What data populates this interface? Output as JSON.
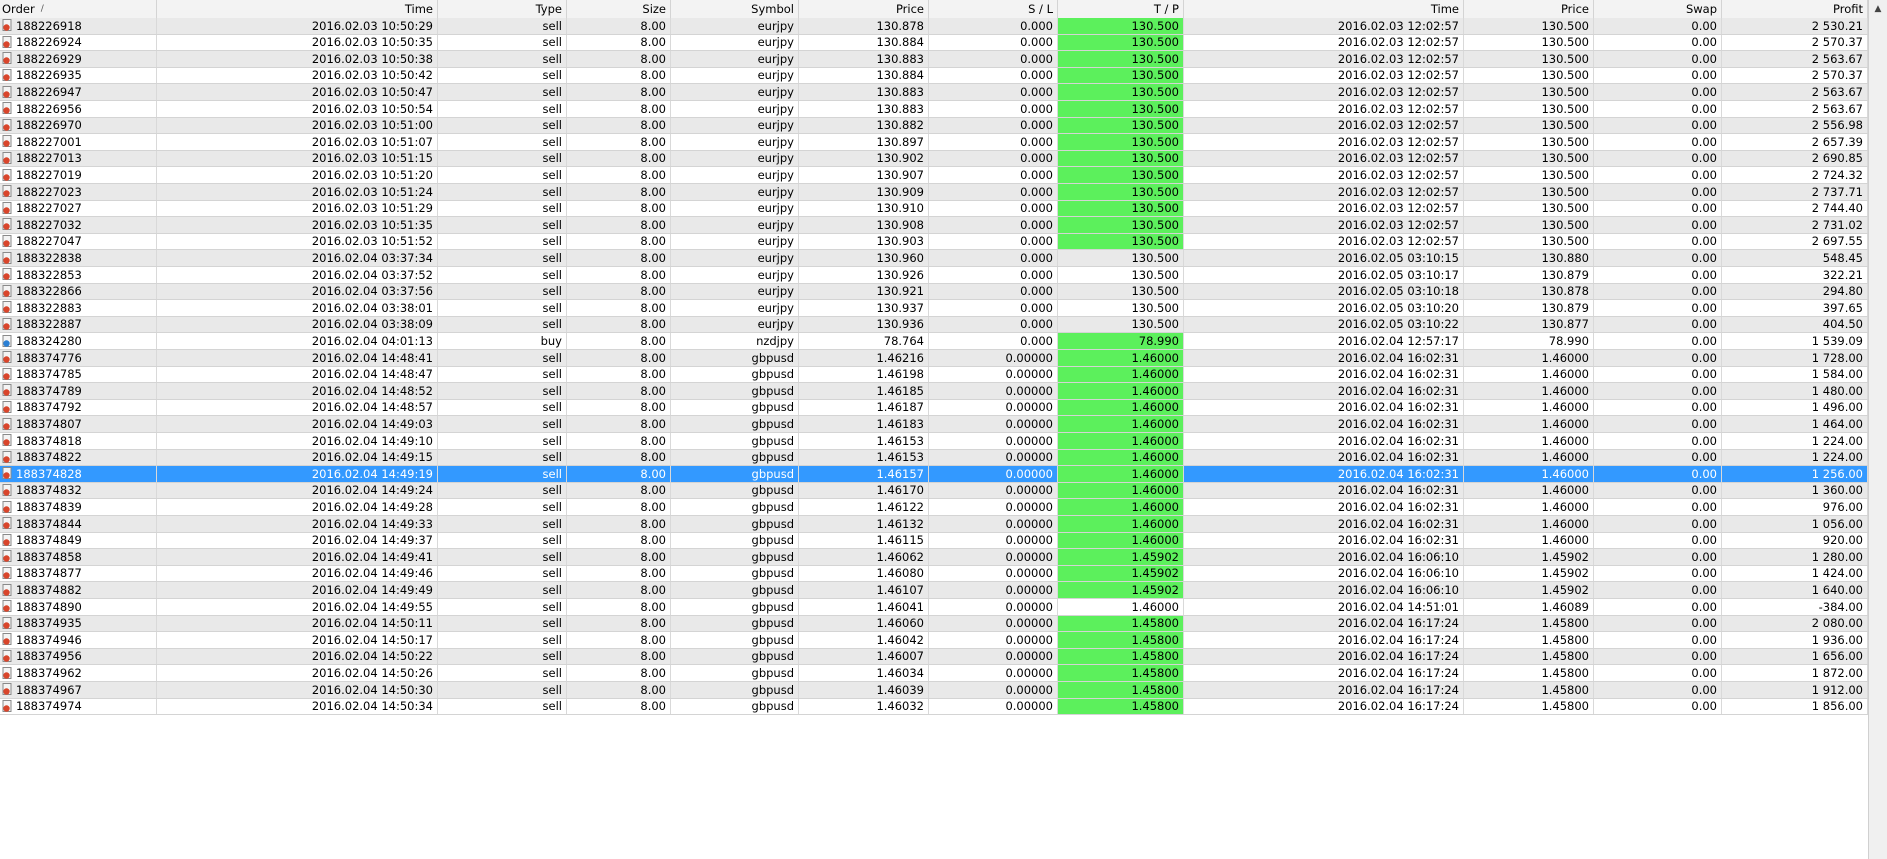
{
  "columns": [
    {
      "key": "order",
      "label": "Order",
      "sort_indicator": "/"
    },
    {
      "key": "open_time",
      "label": "Time"
    },
    {
      "key": "type",
      "label": "Type"
    },
    {
      "key": "size",
      "label": "Size"
    },
    {
      "key": "symbol",
      "label": "Symbol"
    },
    {
      "key": "open_price",
      "label": "Price"
    },
    {
      "key": "sl",
      "label": "S / L"
    },
    {
      "key": "tp",
      "label": "T / P"
    },
    {
      "key": "close_time",
      "label": "Time"
    },
    {
      "key": "close_price",
      "label": "Price"
    },
    {
      "key": "swap",
      "label": "Swap"
    },
    {
      "key": "profit",
      "label": "Profit"
    }
  ],
  "scrollbar_up_arrow": "▲",
  "colors": {
    "tp_hit": "#5cf05c",
    "selected": "#3399ff",
    "sell_icon": "#d9452b",
    "buy_icon": "#2a7fd4"
  },
  "rows": [
    {
      "order": "188226918",
      "open_time": "2016.02.03 10:50:29",
      "type": "sell",
      "size": "8.00",
      "symbol": "eurjpy",
      "open_price": "130.878",
      "sl": "0.000",
      "tp": "130.500",
      "tp_hit": true,
      "close_time": "2016.02.03 12:02:57",
      "close_price": "130.500",
      "swap": "0.00",
      "profit": "2 530.21"
    },
    {
      "order": "188226924",
      "open_time": "2016.02.03 10:50:35",
      "type": "sell",
      "size": "8.00",
      "symbol": "eurjpy",
      "open_price": "130.884",
      "sl": "0.000",
      "tp": "130.500",
      "tp_hit": true,
      "close_time": "2016.02.03 12:02:57",
      "close_price": "130.500",
      "swap": "0.00",
      "profit": "2 570.37"
    },
    {
      "order": "188226929",
      "open_time": "2016.02.03 10:50:38",
      "type": "sell",
      "size": "8.00",
      "symbol": "eurjpy",
      "open_price": "130.883",
      "sl": "0.000",
      "tp": "130.500",
      "tp_hit": true,
      "close_time": "2016.02.03 12:02:57",
      "close_price": "130.500",
      "swap": "0.00",
      "profit": "2 563.67"
    },
    {
      "order": "188226935",
      "open_time": "2016.02.03 10:50:42",
      "type": "sell",
      "size": "8.00",
      "symbol": "eurjpy",
      "open_price": "130.884",
      "sl": "0.000",
      "tp": "130.500",
      "tp_hit": true,
      "close_time": "2016.02.03 12:02:57",
      "close_price": "130.500",
      "swap": "0.00",
      "profit": "2 570.37"
    },
    {
      "order": "188226947",
      "open_time": "2016.02.03 10:50:47",
      "type": "sell",
      "size": "8.00",
      "symbol": "eurjpy",
      "open_price": "130.883",
      "sl": "0.000",
      "tp": "130.500",
      "tp_hit": true,
      "close_time": "2016.02.03 12:02:57",
      "close_price": "130.500",
      "swap": "0.00",
      "profit": "2 563.67"
    },
    {
      "order": "188226956",
      "open_time": "2016.02.03 10:50:54",
      "type": "sell",
      "size": "8.00",
      "symbol": "eurjpy",
      "open_price": "130.883",
      "sl": "0.000",
      "tp": "130.500",
      "tp_hit": true,
      "close_time": "2016.02.03 12:02:57",
      "close_price": "130.500",
      "swap": "0.00",
      "profit": "2 563.67"
    },
    {
      "order": "188226970",
      "open_time": "2016.02.03 10:51:00",
      "type": "sell",
      "size": "8.00",
      "symbol": "eurjpy",
      "open_price": "130.882",
      "sl": "0.000",
      "tp": "130.500",
      "tp_hit": true,
      "close_time": "2016.02.03 12:02:57",
      "close_price": "130.500",
      "swap": "0.00",
      "profit": "2 556.98"
    },
    {
      "order": "188227001",
      "open_time": "2016.02.03 10:51:07",
      "type": "sell",
      "size": "8.00",
      "symbol": "eurjpy",
      "open_price": "130.897",
      "sl": "0.000",
      "tp": "130.500",
      "tp_hit": true,
      "close_time": "2016.02.03 12:02:57",
      "close_price": "130.500",
      "swap": "0.00",
      "profit": "2 657.39"
    },
    {
      "order": "188227013",
      "open_time": "2016.02.03 10:51:15",
      "type": "sell",
      "size": "8.00",
      "symbol": "eurjpy",
      "open_price": "130.902",
      "sl": "0.000",
      "tp": "130.500",
      "tp_hit": true,
      "close_time": "2016.02.03 12:02:57",
      "close_price": "130.500",
      "swap": "0.00",
      "profit": "2 690.85"
    },
    {
      "order": "188227019",
      "open_time": "2016.02.03 10:51:20",
      "type": "sell",
      "size": "8.00",
      "symbol": "eurjpy",
      "open_price": "130.907",
      "sl": "0.000",
      "tp": "130.500",
      "tp_hit": true,
      "close_time": "2016.02.03 12:02:57",
      "close_price": "130.500",
      "swap": "0.00",
      "profit": "2 724.32"
    },
    {
      "order": "188227023",
      "open_time": "2016.02.03 10:51:24",
      "type": "sell",
      "size": "8.00",
      "symbol": "eurjpy",
      "open_price": "130.909",
      "sl": "0.000",
      "tp": "130.500",
      "tp_hit": true,
      "close_time": "2016.02.03 12:02:57",
      "close_price": "130.500",
      "swap": "0.00",
      "profit": "2 737.71"
    },
    {
      "order": "188227027",
      "open_time": "2016.02.03 10:51:29",
      "type": "sell",
      "size": "8.00",
      "symbol": "eurjpy",
      "open_price": "130.910",
      "sl": "0.000",
      "tp": "130.500",
      "tp_hit": true,
      "close_time": "2016.02.03 12:02:57",
      "close_price": "130.500",
      "swap": "0.00",
      "profit": "2 744.40"
    },
    {
      "order": "188227032",
      "open_time": "2016.02.03 10:51:35",
      "type": "sell",
      "size": "8.00",
      "symbol": "eurjpy",
      "open_price": "130.908",
      "sl": "0.000",
      "tp": "130.500",
      "tp_hit": true,
      "close_time": "2016.02.03 12:02:57",
      "close_price": "130.500",
      "swap": "0.00",
      "profit": "2 731.02"
    },
    {
      "order": "188227047",
      "open_time": "2016.02.03 10:51:52",
      "type": "sell",
      "size": "8.00",
      "symbol": "eurjpy",
      "open_price": "130.903",
      "sl": "0.000",
      "tp": "130.500",
      "tp_hit": true,
      "close_time": "2016.02.03 12:02:57",
      "close_price": "130.500",
      "swap": "0.00",
      "profit": "2 697.55"
    },
    {
      "order": "188322838",
      "open_time": "2016.02.04 03:37:34",
      "type": "sell",
      "size": "8.00",
      "symbol": "eurjpy",
      "open_price": "130.960",
      "sl": "0.000",
      "tp": "130.500",
      "tp_hit": false,
      "close_time": "2016.02.05 03:10:15",
      "close_price": "130.880",
      "swap": "0.00",
      "profit": "548.45"
    },
    {
      "order": "188322853",
      "open_time": "2016.02.04 03:37:52",
      "type": "sell",
      "size": "8.00",
      "symbol": "eurjpy",
      "open_price": "130.926",
      "sl": "0.000",
      "tp": "130.500",
      "tp_hit": false,
      "close_time": "2016.02.05 03:10:17",
      "close_price": "130.879",
      "swap": "0.00",
      "profit": "322.21"
    },
    {
      "order": "188322866",
      "open_time": "2016.02.04 03:37:56",
      "type": "sell",
      "size": "8.00",
      "symbol": "eurjpy",
      "open_price": "130.921",
      "sl": "0.000",
      "tp": "130.500",
      "tp_hit": false,
      "close_time": "2016.02.05 03:10:18",
      "close_price": "130.878",
      "swap": "0.00",
      "profit": "294.80"
    },
    {
      "order": "188322883",
      "open_time": "2016.02.04 03:38:01",
      "type": "sell",
      "size": "8.00",
      "symbol": "eurjpy",
      "open_price": "130.937",
      "sl": "0.000",
      "tp": "130.500",
      "tp_hit": false,
      "close_time": "2016.02.05 03:10:20",
      "close_price": "130.879",
      "swap": "0.00",
      "profit": "397.65"
    },
    {
      "order": "188322887",
      "open_time": "2016.02.04 03:38:09",
      "type": "sell",
      "size": "8.00",
      "symbol": "eurjpy",
      "open_price": "130.936",
      "sl": "0.000",
      "tp": "130.500",
      "tp_hit": false,
      "close_time": "2016.02.05 03:10:22",
      "close_price": "130.877",
      "swap": "0.00",
      "profit": "404.50"
    },
    {
      "order": "188324280",
      "open_time": "2016.02.04 04:01:13",
      "type": "buy",
      "size": "8.00",
      "symbol": "nzdjpy",
      "open_price": "78.764",
      "sl": "0.000",
      "tp": "78.990",
      "tp_hit": true,
      "close_time": "2016.02.04 12:57:17",
      "close_price": "78.990",
      "swap": "0.00",
      "profit": "1 539.09"
    },
    {
      "order": "188374776",
      "open_time": "2016.02.04 14:48:41",
      "type": "sell",
      "size": "8.00",
      "symbol": "gbpusd",
      "open_price": "1.46216",
      "sl": "0.00000",
      "tp": "1.46000",
      "tp_hit": true,
      "close_time": "2016.02.04 16:02:31",
      "close_price": "1.46000",
      "swap": "0.00",
      "profit": "1 728.00"
    },
    {
      "order": "188374785",
      "open_time": "2016.02.04 14:48:47",
      "type": "sell",
      "size": "8.00",
      "symbol": "gbpusd",
      "open_price": "1.46198",
      "sl": "0.00000",
      "tp": "1.46000",
      "tp_hit": true,
      "close_time": "2016.02.04 16:02:31",
      "close_price": "1.46000",
      "swap": "0.00",
      "profit": "1 584.00"
    },
    {
      "order": "188374789",
      "open_time": "2016.02.04 14:48:52",
      "type": "sell",
      "size": "8.00",
      "symbol": "gbpusd",
      "open_price": "1.46185",
      "sl": "0.00000",
      "tp": "1.46000",
      "tp_hit": true,
      "close_time": "2016.02.04 16:02:31",
      "close_price": "1.46000",
      "swap": "0.00",
      "profit": "1 480.00"
    },
    {
      "order": "188374792",
      "open_time": "2016.02.04 14:48:57",
      "type": "sell",
      "size": "8.00",
      "symbol": "gbpusd",
      "open_price": "1.46187",
      "sl": "0.00000",
      "tp": "1.46000",
      "tp_hit": true,
      "close_time": "2016.02.04 16:02:31",
      "close_price": "1.46000",
      "swap": "0.00",
      "profit": "1 496.00"
    },
    {
      "order": "188374807",
      "open_time": "2016.02.04 14:49:03",
      "type": "sell",
      "size": "8.00",
      "symbol": "gbpusd",
      "open_price": "1.46183",
      "sl": "0.00000",
      "tp": "1.46000",
      "tp_hit": true,
      "close_time": "2016.02.04 16:02:31",
      "close_price": "1.46000",
      "swap": "0.00",
      "profit": "1 464.00"
    },
    {
      "order": "188374818",
      "open_time": "2016.02.04 14:49:10",
      "type": "sell",
      "size": "8.00",
      "symbol": "gbpusd",
      "open_price": "1.46153",
      "sl": "0.00000",
      "tp": "1.46000",
      "tp_hit": true,
      "close_time": "2016.02.04 16:02:31",
      "close_price": "1.46000",
      "swap": "0.00",
      "profit": "1 224.00"
    },
    {
      "order": "188374822",
      "open_time": "2016.02.04 14:49:15",
      "type": "sell",
      "size": "8.00",
      "symbol": "gbpusd",
      "open_price": "1.46153",
      "sl": "0.00000",
      "tp": "1.46000",
      "tp_hit": true,
      "close_time": "2016.02.04 16:02:31",
      "close_price": "1.46000",
      "swap": "0.00",
      "profit": "1 224.00"
    },
    {
      "order": "188374828",
      "open_time": "2016.02.04 14:49:19",
      "type": "sell",
      "size": "8.00",
      "symbol": "gbpusd",
      "open_price": "1.46157",
      "sl": "0.00000",
      "tp": "1.46000",
      "tp_hit": true,
      "close_time": "2016.02.04 16:02:31",
      "close_price": "1.46000",
      "swap": "0.00",
      "profit": "1 256.00",
      "selected": true
    },
    {
      "order": "188374832",
      "open_time": "2016.02.04 14:49:24",
      "type": "sell",
      "size": "8.00",
      "symbol": "gbpusd",
      "open_price": "1.46170",
      "sl": "0.00000",
      "tp": "1.46000",
      "tp_hit": true,
      "close_time": "2016.02.04 16:02:31",
      "close_price": "1.46000",
      "swap": "0.00",
      "profit": "1 360.00"
    },
    {
      "order": "188374839",
      "open_time": "2016.02.04 14:49:28",
      "type": "sell",
      "size": "8.00",
      "symbol": "gbpusd",
      "open_price": "1.46122",
      "sl": "0.00000",
      "tp": "1.46000",
      "tp_hit": true,
      "close_time": "2016.02.04 16:02:31",
      "close_price": "1.46000",
      "swap": "0.00",
      "profit": "976.00"
    },
    {
      "order": "188374844",
      "open_time": "2016.02.04 14:49:33",
      "type": "sell",
      "size": "8.00",
      "symbol": "gbpusd",
      "open_price": "1.46132",
      "sl": "0.00000",
      "tp": "1.46000",
      "tp_hit": true,
      "close_time": "2016.02.04 16:02:31",
      "close_price": "1.46000",
      "swap": "0.00",
      "profit": "1 056.00"
    },
    {
      "order": "188374849",
      "open_time": "2016.02.04 14:49:37",
      "type": "sell",
      "size": "8.00",
      "symbol": "gbpusd",
      "open_price": "1.46115",
      "sl": "0.00000",
      "tp": "1.46000",
      "tp_hit": true,
      "close_time": "2016.02.04 16:02:31",
      "close_price": "1.46000",
      "swap": "0.00",
      "profit": "920.00"
    },
    {
      "order": "188374858",
      "open_time": "2016.02.04 14:49:41",
      "type": "sell",
      "size": "8.00",
      "symbol": "gbpusd",
      "open_price": "1.46062",
      "sl": "0.00000",
      "tp": "1.45902",
      "tp_hit": true,
      "close_time": "2016.02.04 16:06:10",
      "close_price": "1.45902",
      "swap": "0.00",
      "profit": "1 280.00"
    },
    {
      "order": "188374877",
      "open_time": "2016.02.04 14:49:46",
      "type": "sell",
      "size": "8.00",
      "symbol": "gbpusd",
      "open_price": "1.46080",
      "sl": "0.00000",
      "tp": "1.45902",
      "tp_hit": true,
      "close_time": "2016.02.04 16:06:10",
      "close_price": "1.45902",
      "swap": "0.00",
      "profit": "1 424.00"
    },
    {
      "order": "188374882",
      "open_time": "2016.02.04 14:49:49",
      "type": "sell",
      "size": "8.00",
      "symbol": "gbpusd",
      "open_price": "1.46107",
      "sl": "0.00000",
      "tp": "1.45902",
      "tp_hit": true,
      "close_time": "2016.02.04 16:06:10",
      "close_price": "1.45902",
      "swap": "0.00",
      "profit": "1 640.00"
    },
    {
      "order": "188374890",
      "open_time": "2016.02.04 14:49:55",
      "type": "sell",
      "size": "8.00",
      "symbol": "gbpusd",
      "open_price": "1.46041",
      "sl": "0.00000",
      "tp": "1.46000",
      "tp_hit": false,
      "close_time": "2016.02.04 14:51:01",
      "close_price": "1.46089",
      "swap": "0.00",
      "profit": "-384.00"
    },
    {
      "order": "188374935",
      "open_time": "2016.02.04 14:50:11",
      "type": "sell",
      "size": "8.00",
      "symbol": "gbpusd",
      "open_price": "1.46060",
      "sl": "0.00000",
      "tp": "1.45800",
      "tp_hit": true,
      "close_time": "2016.02.04 16:17:24",
      "close_price": "1.45800",
      "swap": "0.00",
      "profit": "2 080.00"
    },
    {
      "order": "188374946",
      "open_time": "2016.02.04 14:50:17",
      "type": "sell",
      "size": "8.00",
      "symbol": "gbpusd",
      "open_price": "1.46042",
      "sl": "0.00000",
      "tp": "1.45800",
      "tp_hit": true,
      "close_time": "2016.02.04 16:17:24",
      "close_price": "1.45800",
      "swap": "0.00",
      "profit": "1 936.00"
    },
    {
      "order": "188374956",
      "open_time": "2016.02.04 14:50:22",
      "type": "sell",
      "size": "8.00",
      "symbol": "gbpusd",
      "open_price": "1.46007",
      "sl": "0.00000",
      "tp": "1.45800",
      "tp_hit": true,
      "close_time": "2016.02.04 16:17:24",
      "close_price": "1.45800",
      "swap": "0.00",
      "profit": "1 656.00"
    },
    {
      "order": "188374962",
      "open_time": "2016.02.04 14:50:26",
      "type": "sell",
      "size": "8.00",
      "symbol": "gbpusd",
      "open_price": "1.46034",
      "sl": "0.00000",
      "tp": "1.45800",
      "tp_hit": true,
      "close_time": "2016.02.04 16:17:24",
      "close_price": "1.45800",
      "swap": "0.00",
      "profit": "1 872.00"
    },
    {
      "order": "188374967",
      "open_time": "2016.02.04 14:50:30",
      "type": "sell",
      "size": "8.00",
      "symbol": "gbpusd",
      "open_price": "1.46039",
      "sl": "0.00000",
      "tp": "1.45800",
      "tp_hit": true,
      "close_time": "2016.02.04 16:17:24",
      "close_price": "1.45800",
      "swap": "0.00",
      "profit": "1 912.00"
    },
    {
      "order": "188374974",
      "open_time": "2016.02.04 14:50:34",
      "type": "sell",
      "size": "8.00",
      "symbol": "gbpusd",
      "open_price": "1.46032",
      "sl": "0.00000",
      "tp": "1.45800",
      "tp_hit": true,
      "close_time": "2016.02.04 16:17:24",
      "close_price": "1.45800",
      "swap": "0.00",
      "profit": "1 856.00"
    }
  ]
}
